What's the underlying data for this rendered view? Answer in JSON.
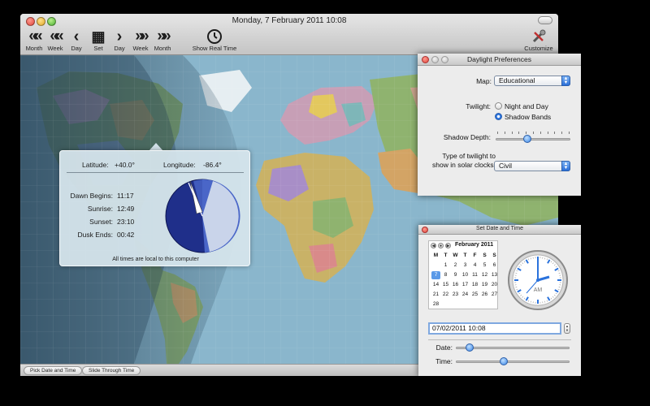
{
  "window": {
    "title": "Monday, 7 February 2011 10:08"
  },
  "toolbar": {
    "buttons": [
      {
        "glyph": "«",
        "label": "Month"
      },
      {
        "glyph": "«",
        "label": "Week"
      },
      {
        "glyph": "‹",
        "label": "Day"
      },
      {
        "glyph": "▦",
        "label": "Set"
      },
      {
        "glyph": "›",
        "label": "Day"
      },
      {
        "glyph": "»",
        "label": "Week"
      },
      {
        "glyph": "»",
        "label": "Month"
      }
    ],
    "show_real_time": "Show Real Time",
    "customize": "Customize"
  },
  "status_bar": {
    "pick_date": "Pick Date and Time",
    "slide_through": "Slide Through Time"
  },
  "location_popover": {
    "latitude_label": "Latitude:",
    "latitude_value": "+40.0°",
    "longitude_label": "Longitude:",
    "longitude_value": "-86.4°",
    "rows": [
      {
        "label": "Dawn Begins:",
        "value": "11:17"
      },
      {
        "label": "Sunrise:",
        "value": "12:49"
      },
      {
        "label": "Sunset:",
        "value": "23:10"
      },
      {
        "label": "Dusk Ends:",
        "value": "00:42"
      }
    ],
    "footnote": "All times are local to this computer"
  },
  "preferences": {
    "title": "Daylight Preferences",
    "map_label": "Map:",
    "map_value": "Educational",
    "twilight_label": "Twilight:",
    "twilight_options": [
      "Night and Day",
      "Shadow Bands"
    ],
    "twilight_selected": "Shadow Bands",
    "shadow_depth_label": "Shadow Depth:",
    "shadow_depth_fraction": 0.42,
    "twilight_type_label": "Type of twilight to show in solar clocks:",
    "twilight_type_value": "Civil"
  },
  "date_panel": {
    "title": "Set Date and Time",
    "calendar": {
      "month_title": "February 2011",
      "weekdays": [
        "M",
        "T",
        "W",
        "T",
        "F",
        "S",
        "S"
      ],
      "weeks": [
        [
          "",
          "1",
          "2",
          "3",
          "4",
          "5",
          "6"
        ],
        [
          "7",
          "8",
          "9",
          "10",
          "11",
          "12",
          "13"
        ],
        [
          "14",
          "15",
          "16",
          "17",
          "18",
          "19",
          "20"
        ],
        [
          "21",
          "22",
          "23",
          "24",
          "25",
          "26",
          "27"
        ],
        [
          "28",
          "",
          "",
          "",
          "",
          "",
          ""
        ]
      ],
      "selected_day": "7"
    },
    "clock_am_pm": "AM",
    "date_field_value": "07/02/2011 10:08",
    "date_slider_label": "Date:",
    "date_slider_fraction": 0.12,
    "time_slider_label": "Time:",
    "time_slider_fraction": 0.42
  },
  "colors": {
    "ocean": "#8ab6cc",
    "night_shade": "#3e5c70",
    "solar_night": "#1f2f8a",
    "solar_day": "#c9d4ea",
    "solar_twilight": "#4a66c8",
    "accent_blue": "#2b6fd8"
  }
}
